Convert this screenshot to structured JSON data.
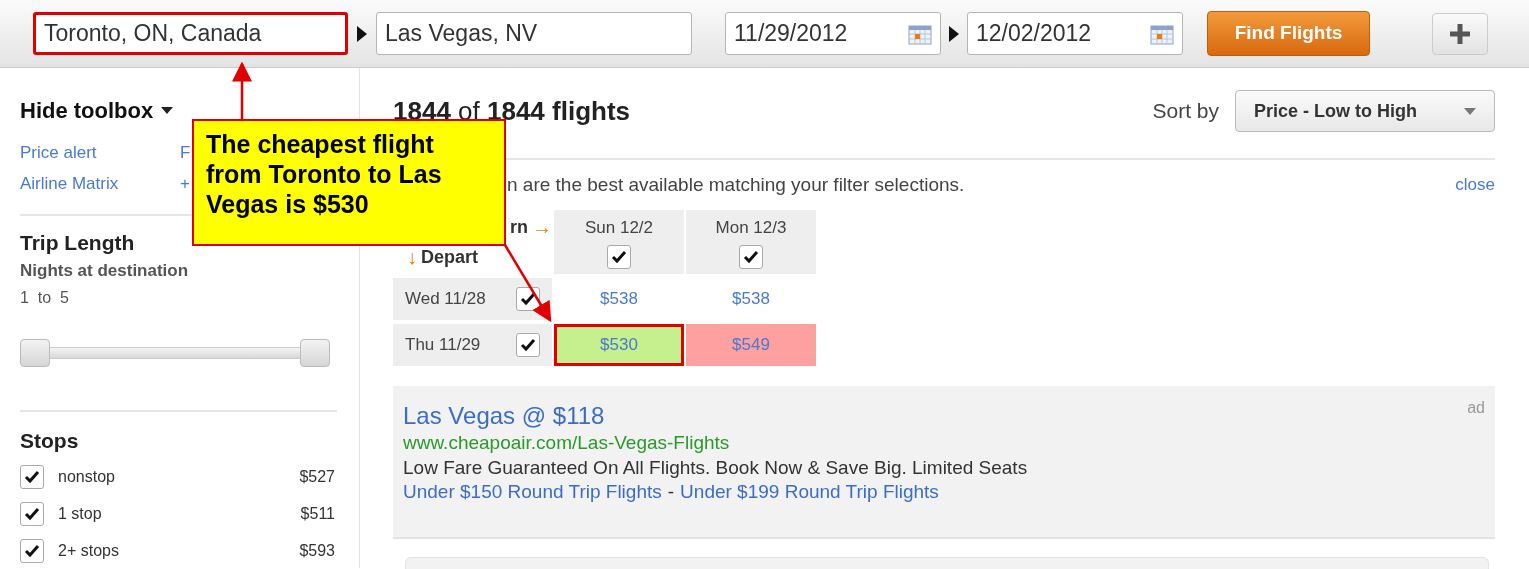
{
  "search_bar": {
    "origin": {
      "value": "Toronto, ON, Canada",
      "highlighted": true
    },
    "destination": {
      "value": "Las Vegas, NV",
      "highlighted": false
    },
    "depart_date": "11/29/2012",
    "return_date": "12/02/2012",
    "find_button": "Find Flights"
  },
  "toolbox": {
    "toggle": "Hide toolbox",
    "links": [
      "Price alert",
      "F",
      "Airline Matrix",
      "+"
    ],
    "trip_length": {
      "title": "Trip Length",
      "subtitle": "Nights at destination",
      "range": "1  to  5",
      "slider": {
        "level": 1
      }
    },
    "stops": {
      "title": "Stops",
      "items": [
        {
          "label": "nonstop",
          "price": "$527",
          "checked": true
        },
        {
          "label": "1 stop",
          "price": "$511",
          "checked": true
        },
        {
          "label": "2+ stops",
          "price": "$593",
          "checked": true
        }
      ]
    }
  },
  "results": {
    "count": "**1844** of **1844 flights**",
    "sort": {
      "label": "Sort by",
      "value": "Price - Low to High"
    },
    "notice": {
      "text": "n are the best available matching your filter selections.",
      "close": "close"
    },
    "matrix": {
      "return_label": "rn",
      "return_arrow": "→",
      "depart_arrow": "↓",
      "depart_label": "Depart",
      "columns": [
        {
          "label": "Sun 12/2",
          "checked": true
        },
        {
          "label": "Mon 12/3",
          "checked": true
        }
      ],
      "rows": [
        {
          "label": "Wed 11/28",
          "checked": true,
          "cells": [
            {
              "price": "$538",
              "color": "#ffffff",
              "highlighted": false
            },
            {
              "price": "$538",
              "color": "#ffffff",
              "highlighted": false
            }
          ]
        },
        {
          "label": "Thu 11/29",
          "checked": true,
          "cells": [
            {
              "price": "$530",
              "color": "#c6ef8e",
              "highlighted": true
            },
            {
              "price": "$549",
              "color": "#ffa0a0",
              "highlighted": false
            }
          ]
        }
      ]
    },
    "ad": {
      "title": "Las Vegas @ $118",
      "url": "www.cheapoair.com/Las-Vegas-Flights",
      "description": "Low Fare Guaranteed On All Flights. Book Now & Save Big. Limited Seats",
      "links": [
        "Under $150 Round Trip Flights",
        "Under $199 Round Trip Flights"
      ],
      "separator": "-",
      "tag": "ad"
    }
  },
  "callout": {
    "text": "The cheapest flight from Toronto to Las Vegas is $530"
  }
}
